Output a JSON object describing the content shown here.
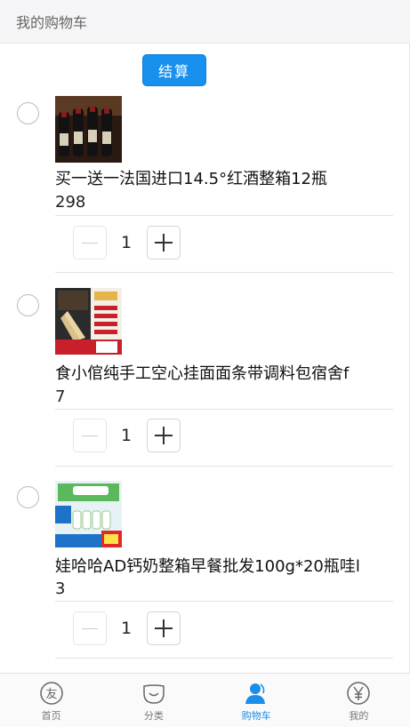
{
  "header": {
    "title": "我的购物车"
  },
  "cart": {
    "checkout_label": "结算",
    "items": [
      {
        "name": "买一送一法国进口14.5°红酒整箱12瓶",
        "price": "298",
        "qty": "1",
        "image": "red-wine-bottles"
      },
      {
        "name": "食小倌纯手工空心挂面面条带调料包宿舍f",
        "price": "7",
        "qty": "1",
        "image": "handmade-noodles"
      },
      {
        "name": "娃哈哈AD钙奶整箱早餐批发100g*20瓶哇l",
        "price": "3",
        "qty": "1",
        "image": "ad-calcium-milk"
      }
    ]
  },
  "tabbar": {
    "tabs": [
      {
        "label": "首页",
        "icon": "friend-icon"
      },
      {
        "label": "分类",
        "icon": "smile-icon"
      },
      {
        "label": "购物车",
        "icon": "user-icon"
      },
      {
        "label": "我的",
        "icon": "yen-icon"
      }
    ],
    "active_color": "#1a8ee8"
  },
  "colors": {
    "accent": "#1890ee",
    "inactive": "#777777"
  }
}
